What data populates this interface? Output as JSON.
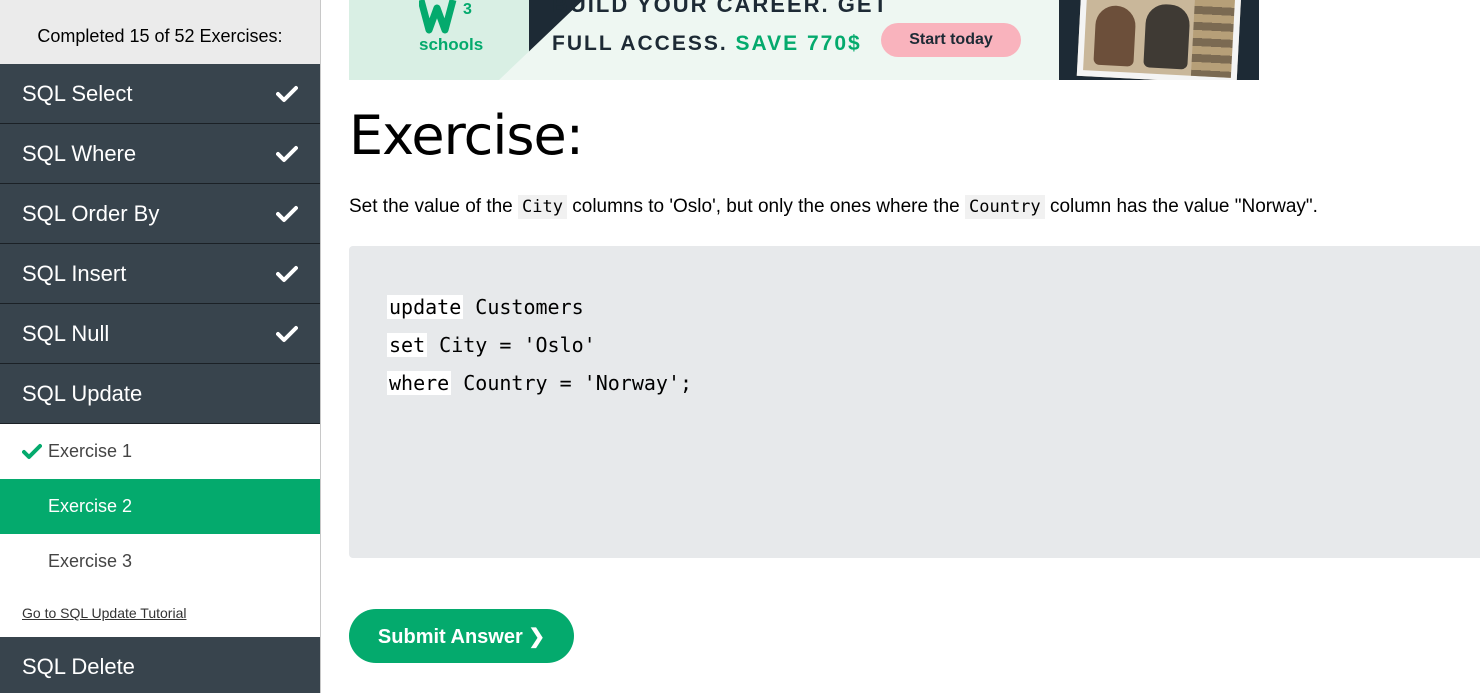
{
  "sidebar": {
    "progress_text": "Completed 15 of 52 Exercises:",
    "chapters_top": [
      {
        "label": "SQL Select"
      },
      {
        "label": "SQL Where"
      },
      {
        "label": "SQL Order By"
      },
      {
        "label": "SQL Insert"
      },
      {
        "label": "SQL Null"
      }
    ],
    "active_chapter": {
      "label": "SQL Update"
    },
    "exercises": [
      {
        "label": "Exercise 1"
      },
      {
        "label": "Exercise 2"
      },
      {
        "label": "Exercise 3"
      }
    ],
    "tutorial_link": "Go to SQL Update Tutorial",
    "chapter_after": {
      "label": "SQL Delete"
    }
  },
  "banner": {
    "logo_text": "schools",
    "logo_sup": "3",
    "line1": "BUILD YOUR CAREER. GET",
    "line2_prefix": "FULL ACCESS.",
    "line2_save": "SAVE 770$",
    "cta": "Start today"
  },
  "main": {
    "title": "Exercise:",
    "instruction": {
      "part1": "Set the value of the",
      "code1": "City",
      "part2": "columns to 'Oslo', but only the ones where the",
      "code2": "Country",
      "part3": "column has the value \"Norway\"."
    },
    "code": [
      {
        "kw": "update",
        "rest": " Customers"
      },
      {
        "kw": "set",
        "rest": " City = 'Oslo'"
      },
      {
        "kw": "where",
        "rest": " Country = 'Norway';"
      }
    ],
    "submit_label": "Submit Answer ❯"
  },
  "colors": {
    "sidebar_dark": "#38444d",
    "accent_green": "#04aa6d",
    "editor_bg": "#e7e9eb"
  }
}
